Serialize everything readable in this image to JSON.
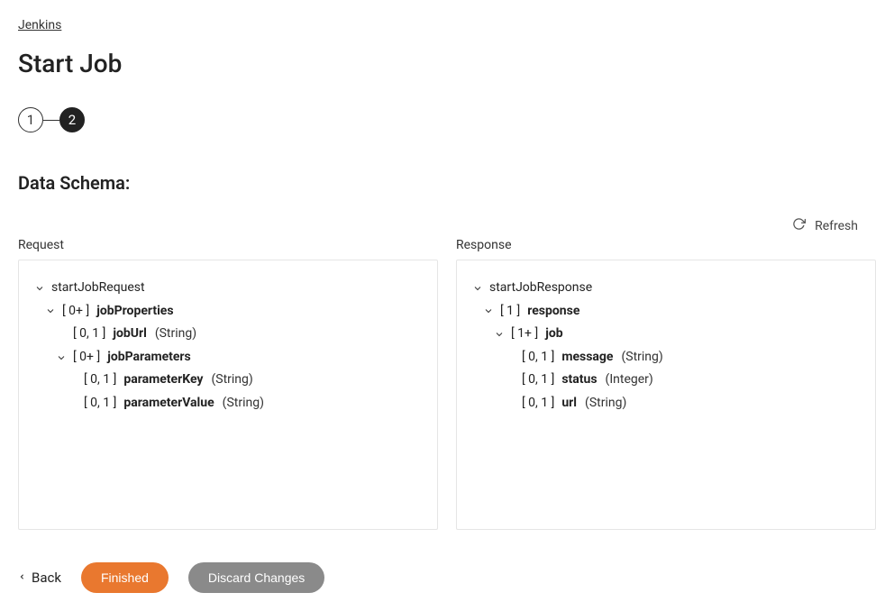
{
  "breadcrumb": "Jenkins",
  "pageTitle": "Start Job",
  "stepper": {
    "step1": "1",
    "step2": "2"
  },
  "sectionTitle": "Data Schema:",
  "refresh": "Refresh",
  "requestLabel": "Request",
  "responseLabel": "Response",
  "requestTree": {
    "root": "startJobRequest",
    "jobProperties": {
      "cardinality": "[ 0+ ]",
      "name": "jobProperties"
    },
    "jobUrl": {
      "cardinality": "[ 0, 1 ]",
      "name": "jobUrl",
      "type": "(String)"
    },
    "jobParameters": {
      "cardinality": "[ 0+ ]",
      "name": "jobParameters"
    },
    "parameterKey": {
      "cardinality": "[ 0, 1 ]",
      "name": "parameterKey",
      "type": "(String)"
    },
    "parameterValue": {
      "cardinality": "[ 0, 1 ]",
      "name": "parameterValue",
      "type": "(String)"
    }
  },
  "responseTree": {
    "root": "startJobResponse",
    "response": {
      "cardinality": "[ 1 ]",
      "name": "response"
    },
    "job": {
      "cardinality": "[ 1+ ]",
      "name": "job"
    },
    "message": {
      "cardinality": "[ 0, 1 ]",
      "name": "message",
      "type": "(String)"
    },
    "status": {
      "cardinality": "[ 0, 1 ]",
      "name": "status",
      "type": "(Integer)"
    },
    "url": {
      "cardinality": "[ 0, 1 ]",
      "name": "url",
      "type": "(String)"
    }
  },
  "buttons": {
    "back": "Back",
    "finished": "Finished",
    "discard": "Discard Changes"
  }
}
